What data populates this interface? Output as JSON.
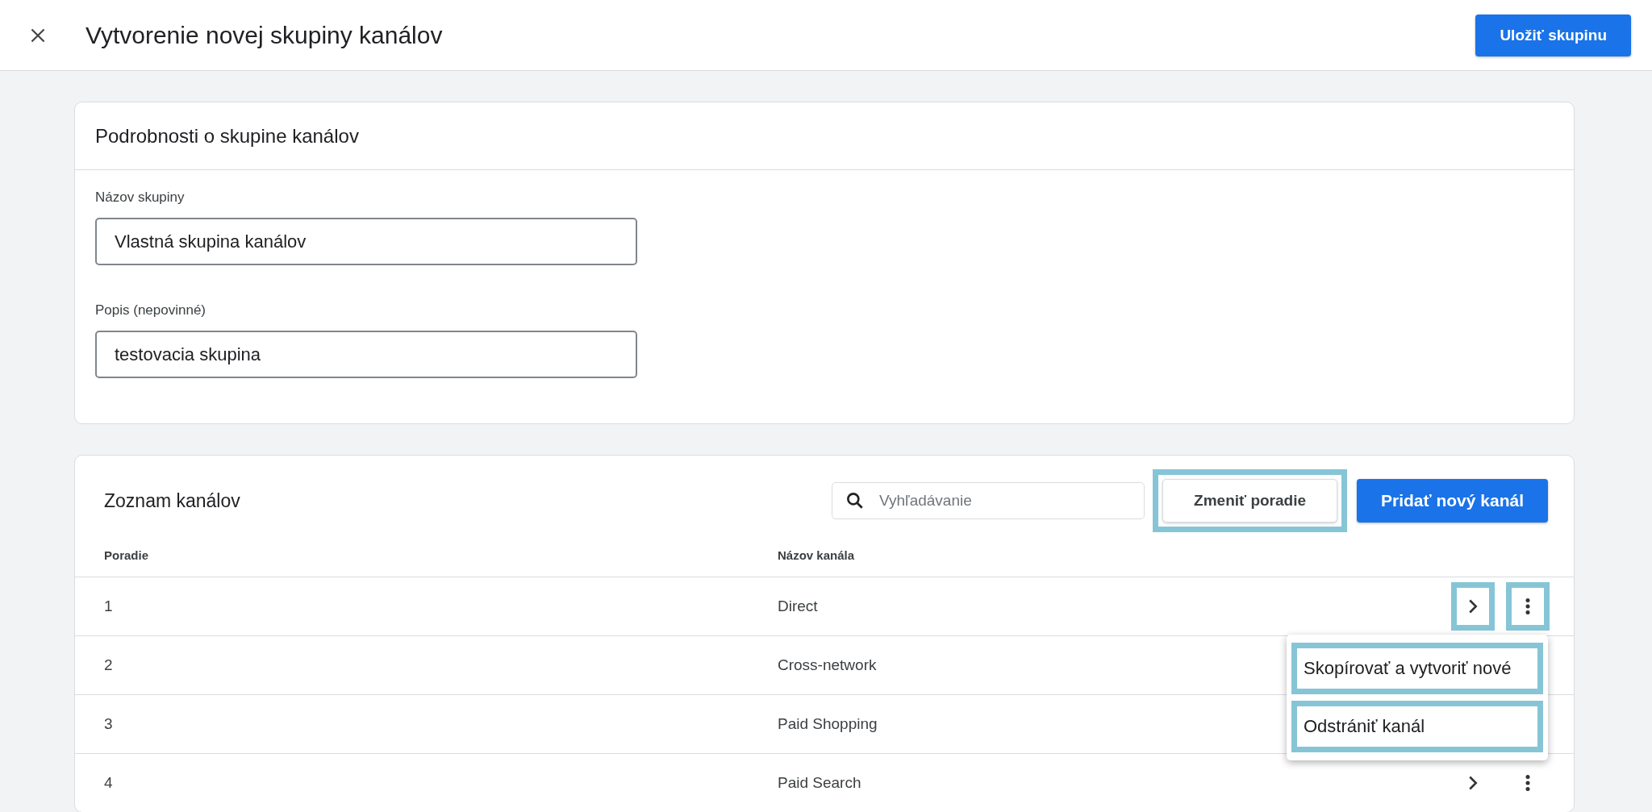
{
  "header": {
    "title": "Vytvorenie novej skupiny kanálov",
    "save_button": "Uložiť skupinu"
  },
  "details": {
    "title": "Podrobnosti o skupine kanálov",
    "fields": [
      {
        "label": "Názov skupiny",
        "value": "Vlastná skupina kanálov"
      },
      {
        "label": "Popis (nepovinné)",
        "value": "testovacia skupina"
      }
    ]
  },
  "channels": {
    "title": "Zoznam kanálov",
    "search": {
      "placeholder": "Vyhľadávanie"
    },
    "reorder_button": {
      "label": "Zmeniť poradie",
      "highlighted": true
    },
    "add_button": {
      "label": "Pridať nový kanál"
    },
    "columns": [
      "Poradie",
      "Názov kanála"
    ],
    "rows": [
      {
        "order": "1",
        "name": "Direct",
        "actions_visible": true,
        "highlighted": true
      },
      {
        "order": "2",
        "name": "Cross-network",
        "actions_visible": false
      },
      {
        "order": "3",
        "name": "Paid Shopping",
        "actions_visible": false
      },
      {
        "order": "4",
        "name": "Paid Search",
        "actions_visible": true,
        "highlighted": false
      }
    ],
    "menu": {
      "open": true,
      "items": [
        {
          "label": "Skopírovať a vytvoriť nové",
          "highlighted": true
        },
        {
          "label": "Odstrániť kanál",
          "highlighted": true
        }
      ]
    }
  }
}
